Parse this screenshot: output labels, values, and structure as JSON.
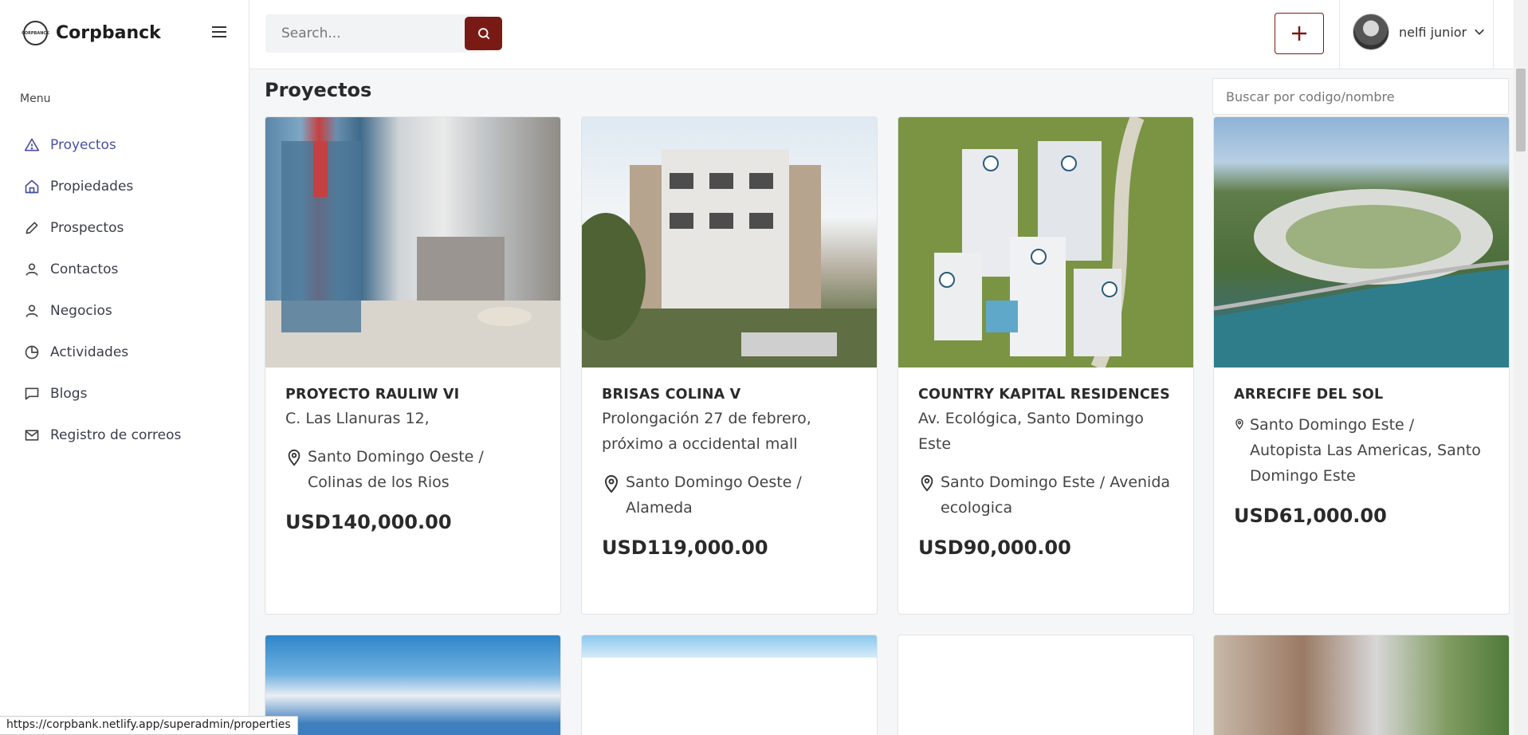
{
  "app": {
    "name": "Corpbanck",
    "logo_text": "CORPBANCK"
  },
  "sidebar": {
    "menu_title": "Menu",
    "items": [
      {
        "label": "Proyectos",
        "icon": "warning-triangle-icon",
        "active": true
      },
      {
        "label": "Propiedades",
        "icon": "home-icon"
      },
      {
        "label": "Prospectos",
        "icon": "pencil-icon"
      },
      {
        "label": "Contactos",
        "icon": "user-icon"
      },
      {
        "label": "Negocios",
        "icon": "user-icon"
      },
      {
        "label": "Actividades",
        "icon": "pie-chart-icon"
      },
      {
        "label": "Blogs",
        "icon": "chat-bubble-icon"
      },
      {
        "label": "Registro de correos",
        "icon": "mail-icon"
      }
    ]
  },
  "header": {
    "search_placeholder": "Search...",
    "user_name": "nelfi junior"
  },
  "main": {
    "title": "Proyectos",
    "filter_placeholder": "Buscar por codigo/nombre",
    "cards": [
      {
        "title": "PROYECTO RAULIW VI",
        "address": "C. Las Llanuras 12,",
        "location": "Santo Domingo Oeste / Colinas de los Rios",
        "price": "USD140,000.00"
      },
      {
        "title": "BRISAS COLINA V",
        "address": "Prolongación 27 de febrero, próximo a occidental mall",
        "location": "Santo Domingo Oeste / Alameda",
        "price": "USD119,000.00"
      },
      {
        "title": "COUNTRY KAPITAL RESIDENCES",
        "address": "Av. Ecológica, Santo Domingo Este",
        "location": "Santo Domingo Este / Avenida ecologica",
        "price": "USD90,000.00"
      },
      {
        "title": "ARRECIFE DEL SOL",
        "address": "",
        "location": "Santo Domingo Este / Autopista Las Americas, Santo Domingo Este",
        "price": "USD61,000.00"
      }
    ]
  },
  "status_url": "https://corpbank.netlify.app/superadmin/properties",
  "colors": {
    "accent": "#7a1a15",
    "active_nav": "#4a4fa3"
  }
}
